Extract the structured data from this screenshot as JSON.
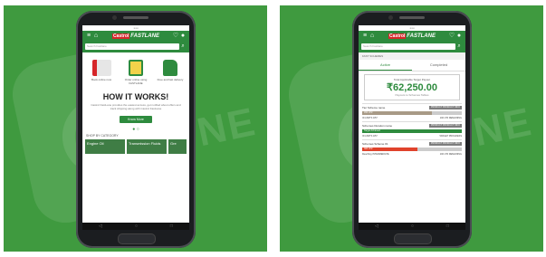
{
  "left": {
    "brand_tag": "Castrol",
    "brand_name": "FASTLANE",
    "search_placeholder": "Search Fastlane",
    "steps": [
      {
        "label": "Book online now"
      },
      {
        "label": "Order online using FASTLANE"
      },
      {
        "label": "Free and fast delivery"
      }
    ],
    "headline": "HOW IT WORKS!",
    "description": "Castrol FastLane provides the easiest access, get notified about offers and track shipping along with Castrol FastLane",
    "cta": "Know More",
    "shop_by_category": "SHOP BY CATEGORY",
    "categories": [
      "Engine Oil",
      "Transmission Fluids",
      "Gre"
    ]
  },
  "right": {
    "brand_tag": "Castrol",
    "brand_name": "FASTLANE",
    "search_placeholder": "Search Fastlane",
    "tabs": [
      "Active",
      "Completed"
    ],
    "section": "FAST SCHEMES",
    "target_label": "Total Applicable Target Payout",
    "target_value": "₹62,250.00",
    "target_note": "Payouts to Schemes Tables",
    "schemes": [
      {
        "name": "Tier Scheme name",
        "button": "PRODUCT PRODUCT INFO",
        "bar_label": "450 LTR",
        "fill": 0.7,
        "color": "#a89a86",
        "meta_left": "ID LIMITS 4/57",
        "meta_right": "100 LTR REMAINING"
      },
      {
        "name": "Schemes Duration name",
        "button": "PRODUCT PRODUCT INFO",
        "bar_label": "Target Achieved",
        "fill": 1.0,
        "color": "#2e8b3e",
        "meta_left": "ID LIMITS 4/57",
        "meta_right": "TARGET PROGRESS"
      },
      {
        "name": "Schemes Scheme #1",
        "button": "PRODUCT PRODUCT INFO",
        "bar_label": "300 LTR",
        "fill": 0.55,
        "color": "#e0432c",
        "meta_left": "Reaching INTERMEDIATE",
        "meta_right": "100 LTR REMAINING"
      }
    ]
  }
}
